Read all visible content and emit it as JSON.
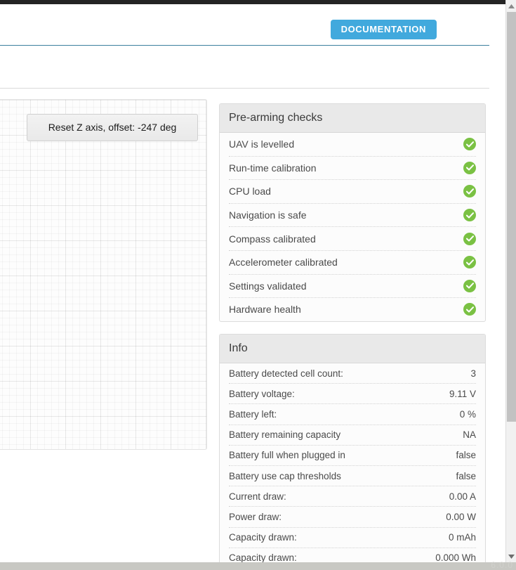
{
  "header": {
    "documentation_label": "DOCUMENTATION"
  },
  "graph_panel": {
    "reset_button_label": "Reset Z axis, offset: -247 deg"
  },
  "prearming": {
    "title": "Pre-arming checks",
    "status_icon": "check-circle-icon",
    "items": [
      {
        "label": "UAV is levelled",
        "status": "ok"
      },
      {
        "label": "Run-time calibration",
        "status": "ok"
      },
      {
        "label": "CPU load",
        "status": "ok"
      },
      {
        "label": "Navigation is safe",
        "status": "ok"
      },
      {
        "label": "Compass calibrated",
        "status": "ok"
      },
      {
        "label": "Accelerometer calibrated",
        "status": "ok"
      },
      {
        "label": "Settings validated",
        "status": "ok"
      },
      {
        "label": "Hardware health",
        "status": "ok"
      }
    ]
  },
  "info": {
    "title": "Info",
    "rows": [
      {
        "label": "Battery detected cell count:",
        "value": "3"
      },
      {
        "label": "Battery voltage:",
        "value": "9.11 V"
      },
      {
        "label": "Battery left:",
        "value": "0 %"
      },
      {
        "label": "Battery remaining capacity",
        "value": "NA"
      },
      {
        "label": "Battery full when plugged in",
        "value": "false"
      },
      {
        "label": "Battery use cap thresholds",
        "value": "false"
      },
      {
        "label": "Current draw:",
        "value": "0.00 A"
      },
      {
        "label": "Power draw:",
        "value": "0.00 W"
      },
      {
        "label": "Capacity drawn:",
        "value": "0 mAh"
      },
      {
        "label": "Capacity drawn:",
        "value": "0.000 Wh"
      }
    ]
  },
  "footer": {
    "version": "6.0.0"
  },
  "colors": {
    "accent_blue": "#41a9dd",
    "rule_blue": "#3b7f9e",
    "status_green": "#7ac143",
    "panel_header_gray": "#e9e9e9"
  }
}
